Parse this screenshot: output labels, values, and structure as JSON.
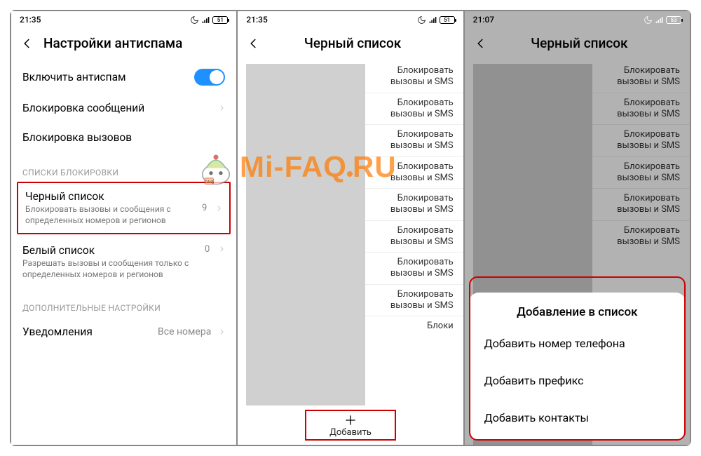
{
  "watermark_text": "Mi-FAQ.RU",
  "screen1": {
    "time": "21:35",
    "battery": "51",
    "title": "Настройки антиспама",
    "enable_label": "Включить антиспам",
    "block_msgs": "Блокировка сообщений",
    "block_calls": "Блокировка вызовов",
    "section_blocklists": "СПИСКИ БЛОКИРОВКИ",
    "blacklist": {
      "title": "Черный список",
      "sub": "Блокировать вызовы и сообщения с определенных номеров и регионов",
      "count": "9"
    },
    "whitelist": {
      "title": "Белый список",
      "sub": "Разрешать вызовы и сообщения только с определенных номеров и регионов",
      "count": "0"
    },
    "section_additional": "ДОПОЛНИТЕЛЬНЫЕ НАСТРОЙКИ",
    "notif_label": "Уведомления",
    "notif_value": "Все номера"
  },
  "screen2": {
    "time": "21:35",
    "battery": "51",
    "title": "Черный список",
    "item_text": "Блокировать вызовы и SMS",
    "partial_text": "Блоки",
    "add_label": "Добавить"
  },
  "screen3": {
    "time": "21:07",
    "battery": "53",
    "title": "Черный список",
    "item_text": "Блокировать вызовы и SMS",
    "sheet_title": "Добавление в список",
    "sheet_items": [
      "Добавить номер телефона",
      "Добавить префикс",
      "Добавить контакты"
    ]
  }
}
